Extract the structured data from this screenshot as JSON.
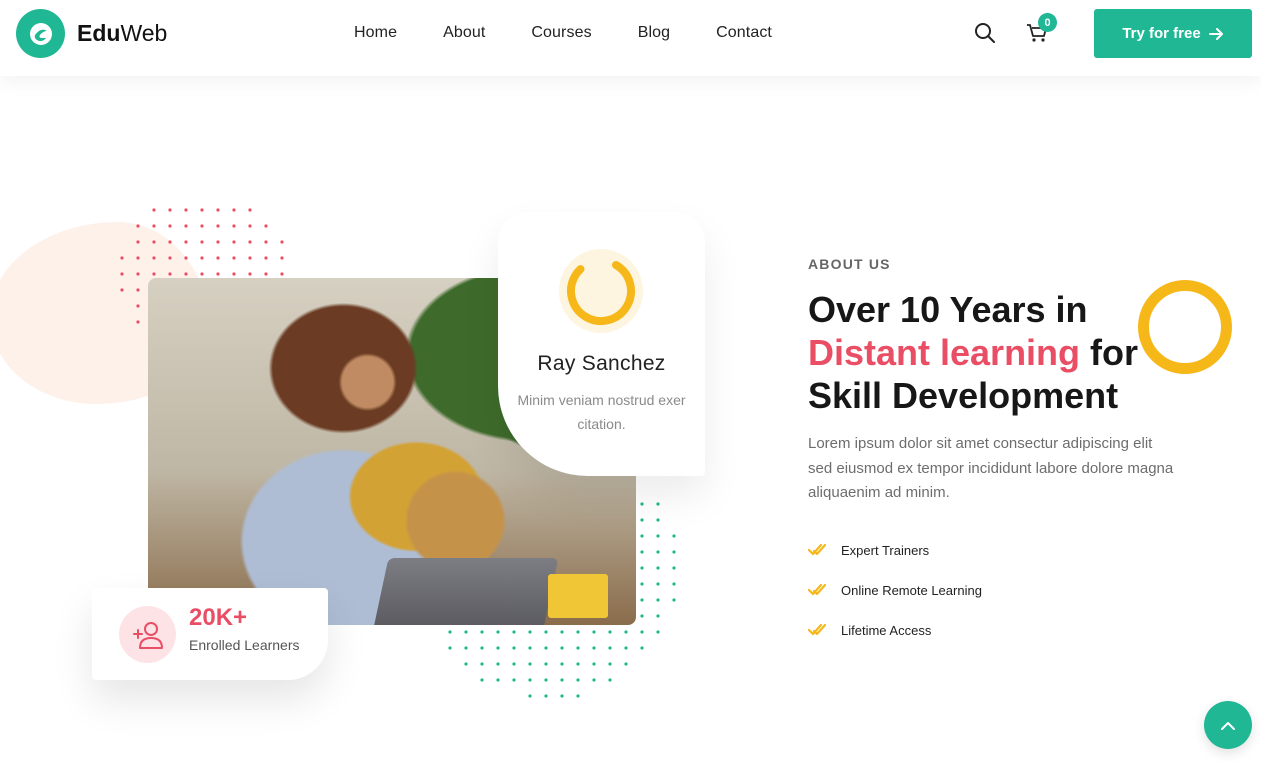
{
  "brand": {
    "name_bold": "Edu",
    "name_regular": "Web",
    "logo_icon": "e-leaf-icon",
    "accent": "#20b795"
  },
  "nav": {
    "items": [
      {
        "label": "Home"
      },
      {
        "label": "About"
      },
      {
        "label": "Courses"
      },
      {
        "label": "Blog"
      },
      {
        "label": "Contact"
      }
    ]
  },
  "header": {
    "search_icon": "search-icon",
    "cart_icon": "cart-icon",
    "cart_count": "0",
    "cta_label": "Try for free",
    "cta_icon": "arrow-right-icon"
  },
  "about": {
    "eyebrow": "ABOUT US",
    "heading_line1": "Over 10 Years in",
    "heading_accent": "Distant learning",
    "heading_after_accent": " for",
    "heading_line3": "Skill Development",
    "paragraph": "Lorem ipsum dolor sit amet consectur adipiscing elit sed eiusmod ex tempor incididunt labore dolore magna aliquaenim ad minim.",
    "features": [
      {
        "label": "Expert Trainers"
      },
      {
        "label": "Online Remote Learning"
      },
      {
        "label": "Lifetime Access"
      }
    ],
    "accent_color": "#ea4e65",
    "ring_color": "#f6b719"
  },
  "profile_card": {
    "name": "Ray Sanchez",
    "subtitle": "Minim veniam nostrud exer citation."
  },
  "stat_card": {
    "value": "20K+",
    "label": "Enrolled Learners",
    "icon": "add-user-icon"
  },
  "back_to_top": {
    "icon": "chevron-up-icon"
  }
}
